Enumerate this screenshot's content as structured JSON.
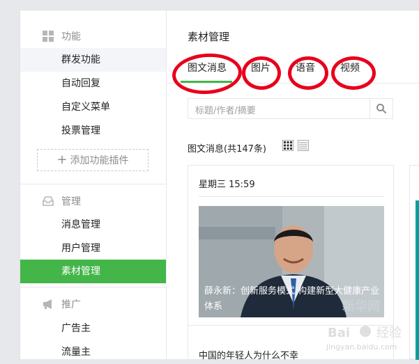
{
  "sidebar": {
    "sections": [
      {
        "title": "功能",
        "icon": "grid-icon"
      },
      {
        "title": "管理",
        "icon": "inbox-icon"
      },
      {
        "title": "推广",
        "icon": "megaphone-icon"
      }
    ],
    "items": [
      {
        "label": "群发功能"
      },
      {
        "label": "自动回复"
      },
      {
        "label": "自定义菜单"
      },
      {
        "label": "投票管理"
      },
      {
        "label": "消息管理"
      },
      {
        "label": "用户管理"
      },
      {
        "label": "素材管理"
      },
      {
        "label": "广告主"
      },
      {
        "label": "流量主"
      }
    ],
    "add_plugin": "添加功能插件"
  },
  "main": {
    "title": "素材管理",
    "tabs": [
      {
        "label": "图文消息"
      },
      {
        "label": "图片"
      },
      {
        "label": "语音"
      },
      {
        "label": "视频"
      }
    ],
    "search_placeholder": "标题/作者/摘要",
    "count_text": "图文消息(共147条)",
    "cards": [
      {
        "date": "星期三 15:59",
        "cover_title": "薛永新：创新服务模式 构建新型大健康产业体系",
        "watermark": "新华网",
        "second_title": "中国的年轻人为什么不幸"
      }
    ]
  },
  "colors": {
    "accent": "#44b549",
    "annotation": "#e8001c",
    "peek_accent": "#00a0a0"
  }
}
